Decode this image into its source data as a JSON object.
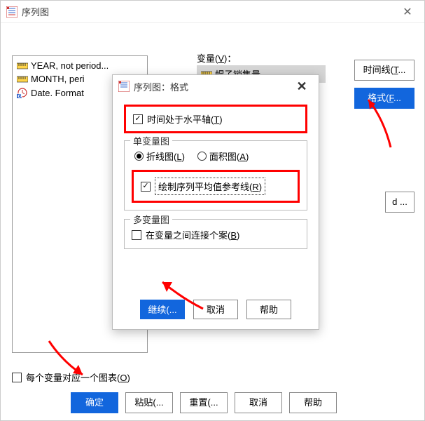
{
  "main": {
    "title": "序列图",
    "close": "✕",
    "left_items": [
      "YEAR, not period...",
      "MONTH, peri",
      "Date.  Format"
    ],
    "var_label": "变量(",
    "var_mn": "V",
    "var_suffix": ")：",
    "var_selected": "帽子销售量",
    "side": {
      "timeline": "时间线(",
      "timeline_mn": "T",
      "timeline_suffix": "...",
      "format": "格式(",
      "format_mn": "F",
      "format_suffix": "..."
    },
    "right_mid_btn": "d ...",
    "bottom_check": "每个变量对应一个图表(",
    "bottom_check_mn": "O",
    "bottom_check_suffix": ")",
    "buttons": {
      "ok": "确定",
      "paste": "粘贴(...",
      "reset": "重置(...",
      "cancel": "取消",
      "help": "帮助"
    }
  },
  "modal": {
    "title": "序列图：格式",
    "close": "✕",
    "chk_time": "时间处于水平轴(",
    "chk_time_mn": "T",
    "chk_time_suffix": ")",
    "group1_title": "单变量图",
    "radio_line": "折线图(",
    "radio_line_mn": "L",
    "radio_line_suffix": ")",
    "radio_area": "面积图(",
    "radio_area_mn": "A",
    "radio_area_suffix": ")",
    "chk_ref": "绘制序列平均值参考线(",
    "chk_ref_mn": "R",
    "chk_ref_suffix": ")",
    "group2_title": "多变量图",
    "chk_connect": "在变量之间连接个案(",
    "chk_connect_mn": "B",
    "chk_connect_suffix": ")",
    "buttons": {
      "continue": "继续(...",
      "cancel": "取消",
      "help": "帮助"
    }
  },
  "colors": {
    "accent": "#1266dd",
    "highlight": "#ff0000"
  }
}
